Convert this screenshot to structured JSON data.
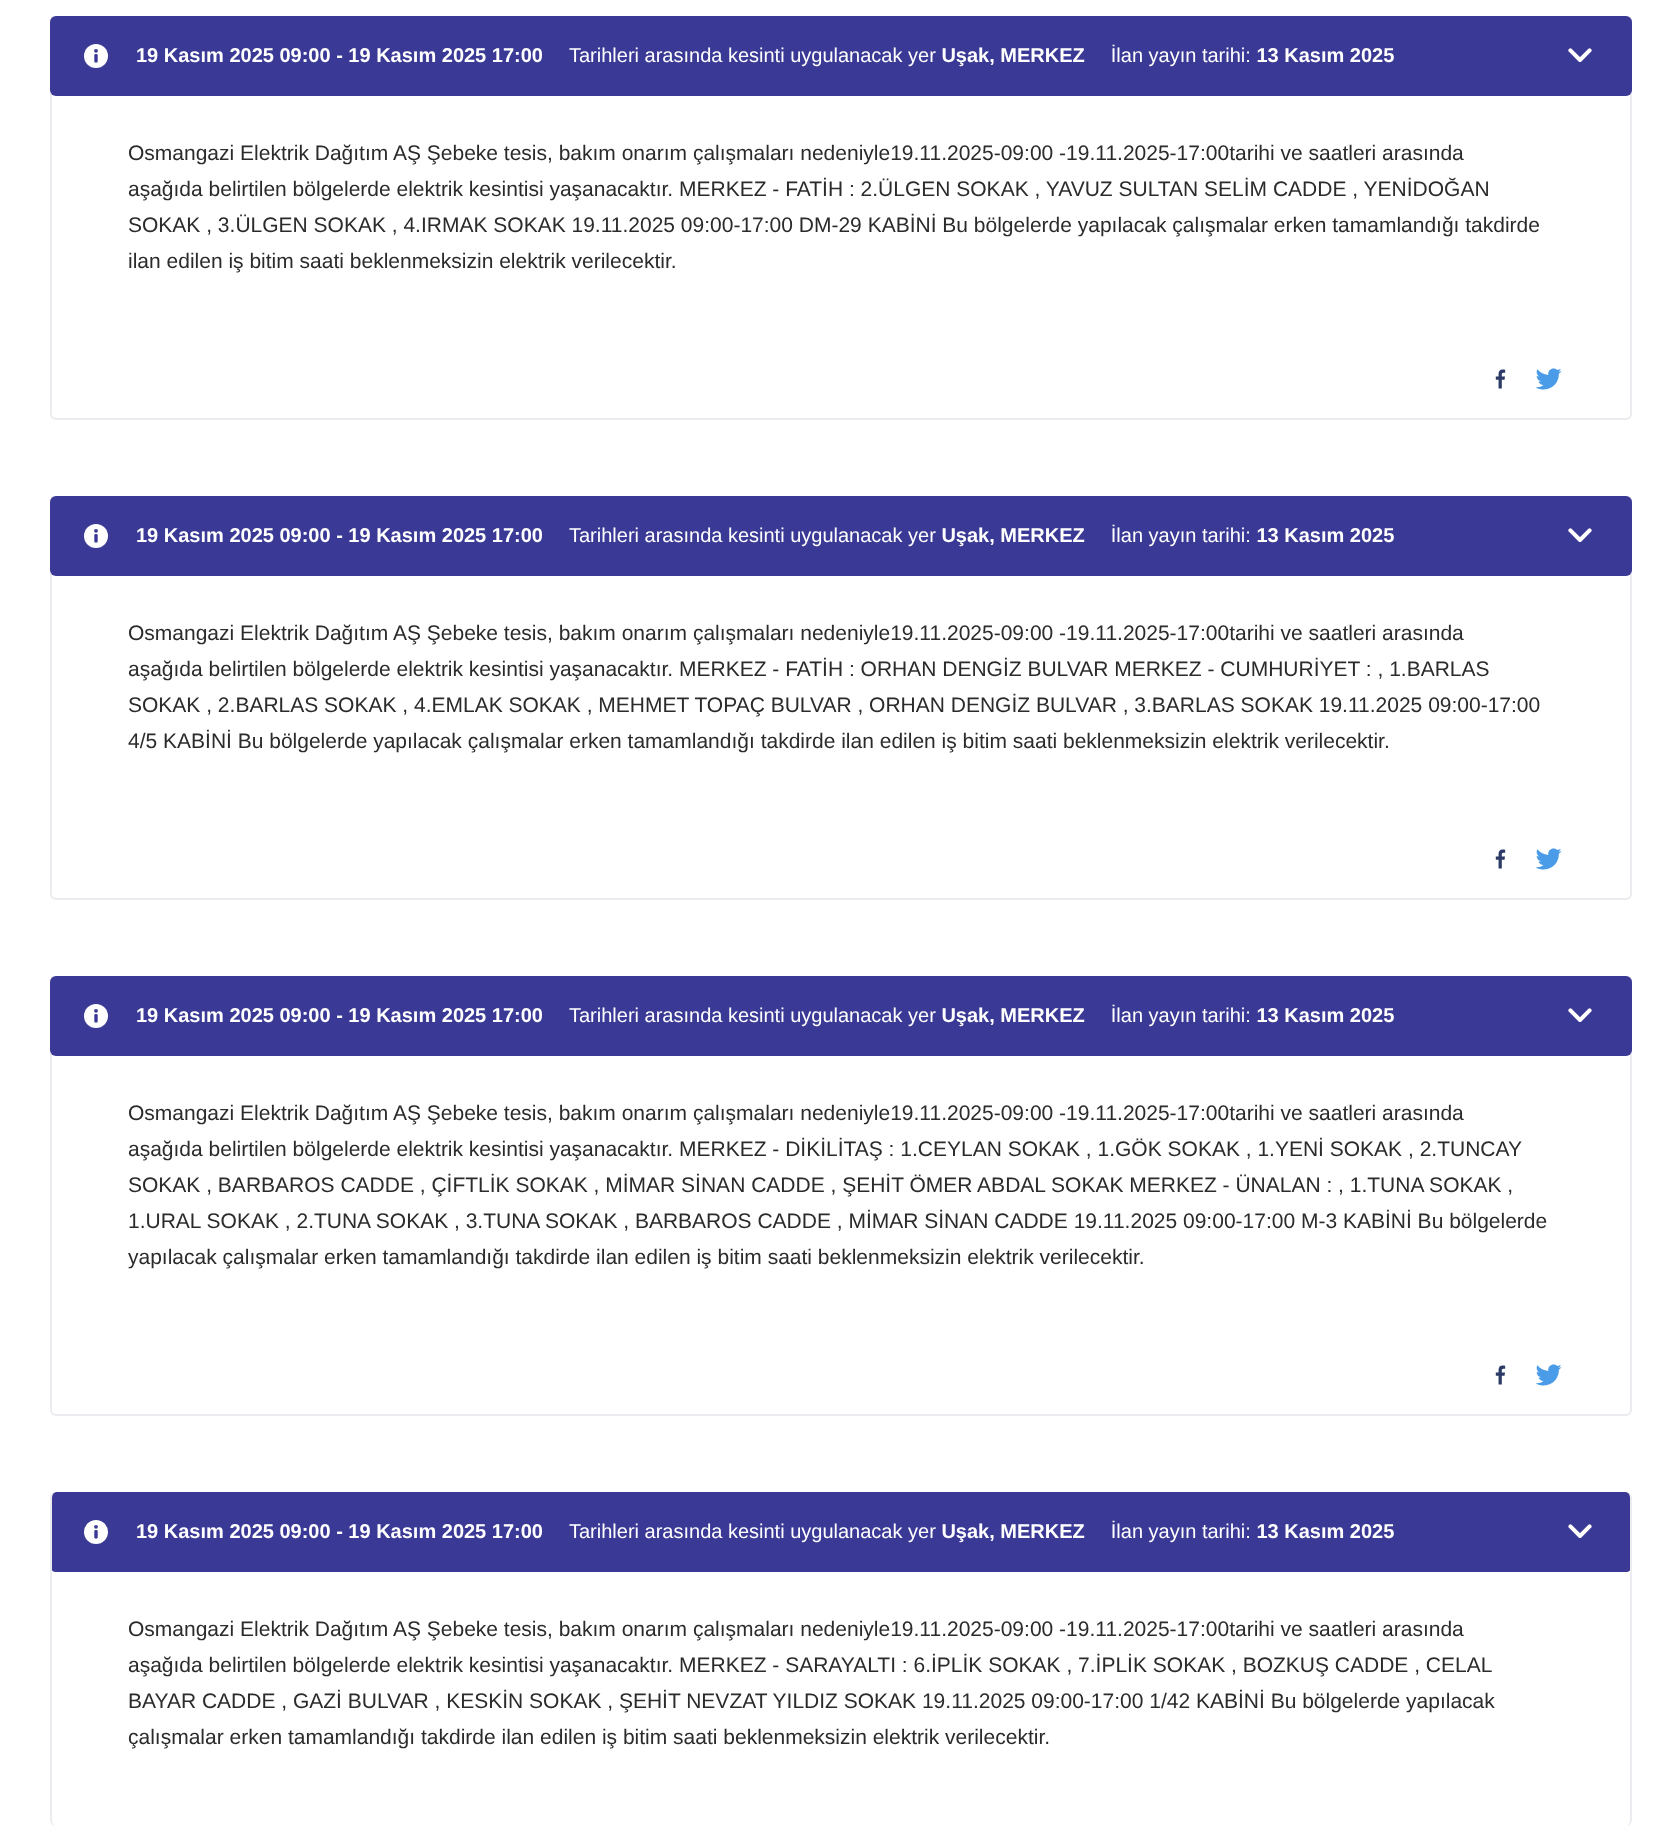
{
  "notices": [
    {
      "date_range": "19 Kasım 2025 09:00 - 19 Kasım 2025 17:00",
      "location": "Tarihleri arasında kesinti uygulanacak yer **Uşak, MERKEZ**",
      "published": "İlan yayın tarihi: **13 Kasım 2025**",
      "expanded": true,
      "description": "Osmangazi Elektrik Dağıtım AŞ Şebeke tesis, bakım onarım çalışmaları nedeniyle19.11.2025-09:00 -19.11.2025-17:00tarihi ve saatleri arasında\naşağıda belirtilen bölgelerde elektrik kesintisi yaşanacaktır. MERKEZ - FATİH : 2.ÜLGEN SOKAK , YAVUZ SULTAN SELİM CADDE , YENİDOĞAN SOKAK , 3.ÜLGEN SOKAK , 4.IRMAK SOKAK 19.11.2025 09:00-17:00 DM-29 KABİNİ Bu bölgelerde yapılacak çalışmalar erken tamamlandığı takdirde ilan edilen iş bitim saati beklenmeksizin elektrik verilecektir.",
      "share_links": true
    },
    {
      "date_range": "19 Kasım 2025 09:00 - 19 Kasım 2025 17:00",
      "location": "Tarihleri arasında kesinti uygulanacak yer **Uşak, MERKEZ**",
      "published": "İlan yayın tarihi: **13 Kasım 2025**",
      "expanded": true,
      "description": "Osmangazi Elektrik Dağıtım AŞ Şebeke tesis, bakım onarım çalışmaları nedeniyle19.11.2025-09:00 -19.11.2025-17:00tarihi ve saatleri arasında\naşağıda belirtilen bölgelerde elektrik kesintisi yaşanacaktır. MERKEZ - FATİH : ORHAN DENGİZ BULVAR MERKEZ - CUMHURİYET : , 1.BARLAS SOKAK , 2.BARLAS SOKAK , 4.EMLAK SOKAK , MEHMET TOPAÇ BULVAR , ORHAN DENGİZ BULVAR , 3.BARLAS SOKAK 19.11.2025 09:00-17:00 4/5 KABİNİ Bu bölgelerde yapılacak çalışmalar erken tamamlandığı takdirde ilan edilen iş bitim saati beklenmeksizin elektrik verilecektir.",
      "share_links": true
    },
    {
      "date_range": "19 Kasım 2025 09:00 - 19 Kasım 2025 17:00",
      "location": "Tarihleri arasında kesinti uygulanacak yer **Uşak, MERKEZ**",
      "published": "İlan yayın tarihi: **13 Kasım 2025**",
      "expanded": true,
      "description": "Osmangazi Elektrik Dağıtım AŞ Şebeke tesis, bakım onarım çalışmaları nedeniyle19.11.2025-09:00 -19.11.2025-17:00tarihi ve saatleri arasında\naşağıda belirtilen bölgelerde elektrik kesintisi yaşanacaktır. MERKEZ - DİKİLİTAŞ : 1.CEYLAN SOKAK , 1.GÖK SOKAK , 1.YENİ SOKAK , 2.TUNCAY SOKAK , BARBAROS CADDE , ÇİFTLİK SOKAK , MİMAR SİNAN CADDE , ŞEHİT ÖMER ABDAL SOKAK MERKEZ - ÜNALAN : , 1.TUNA SOKAK , 1.URAL SOKAK , 2.TUNA SOKAK , 3.TUNA SOKAK , BARBAROS CADDE , MİMAR SİNAN CADDE 19.11.2025 09:00-17:00 M-3 KABİNİ Bu bölgelerde yapılacak çalışmalar erken tamamlandığı takdirde ilan edilen iş bitim saati beklenmeksizin elektrik verilecektir.",
      "share_links": true
    },
    {
      "date_range": "19 Kasım 2025 09:00 - 19 Kasım 2025 17:00",
      "location": "Tarihleri arasında kesinti uygulanacak yer **Uşak, MERKEZ**",
      "published": "İlan yayın tarihi: **13 Kasım 2025**",
      "expanded": true,
      "description": "Osmangazi Elektrik Dağıtım AŞ Şebeke tesis, bakım onarım çalışmaları nedeniyle19.11.2025-09:00 -19.11.2025-17:00tarihi ve saatleri arasında\naşağıda belirtilen bölgelerde elektrik kesintisi yaşanacaktır. MERKEZ - SARAYALTI : 6.İPLİK SOKAK , 7.İPLİK SOKAK , BOZKUŞ CADDE , CELAL BAYAR CADDE , GAZİ BULVAR , KESKİN SOKAK , ŞEHİT NEVZAT YILDIZ SOKAK 19.11.2025 09:00-17:00 1/42 KABİNİ Bu bölgelerde yapılacak çalışmalar erken tamamlandığı takdirde ilan edilen iş bitim saati beklenmeksizin elektrik verilecektir.",
      "share_links": false
    }
  ]
}
